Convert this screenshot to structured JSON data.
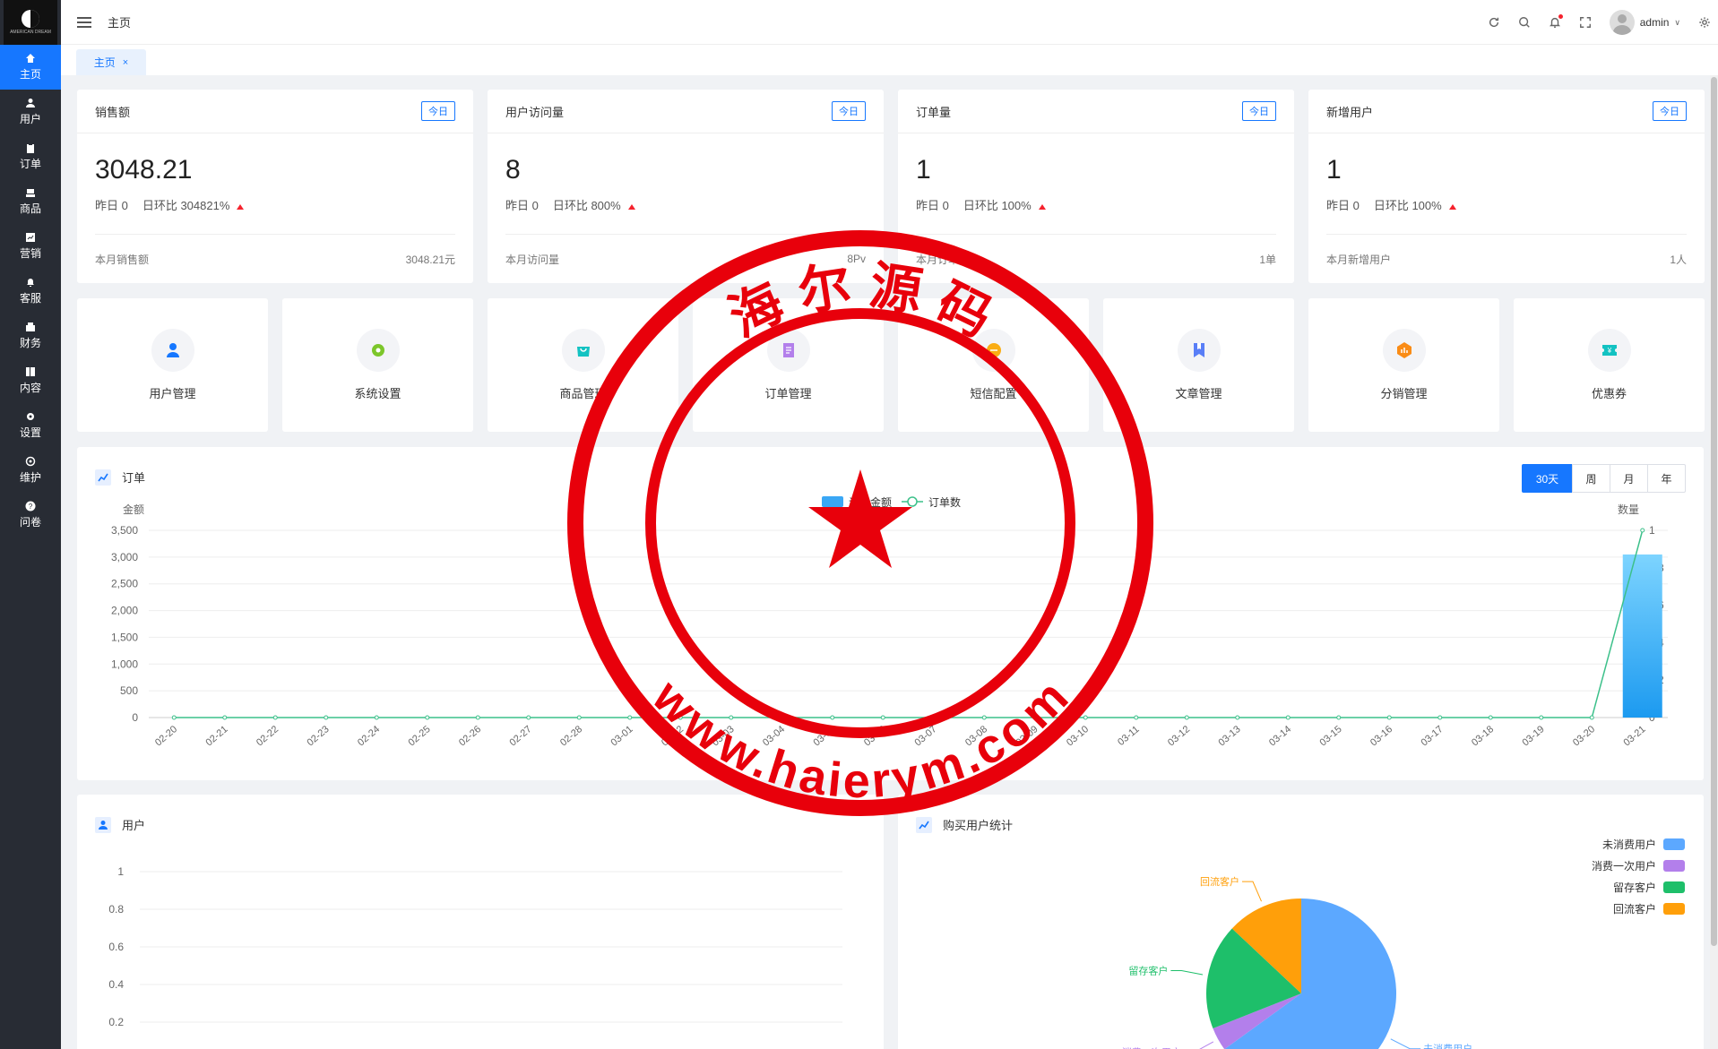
{
  "logo": {
    "text": "AMERICAN DREAM"
  },
  "sidebar": {
    "items": [
      {
        "label": "主页",
        "icon": "home-icon"
      },
      {
        "label": "用户",
        "icon": "user-icon"
      },
      {
        "label": "订单",
        "icon": "clipboard-icon"
      },
      {
        "label": "商品",
        "icon": "product-icon"
      },
      {
        "label": "营销",
        "icon": "chart-icon"
      },
      {
        "label": "客服",
        "icon": "bell-icon"
      },
      {
        "label": "财务",
        "icon": "wallet-icon"
      },
      {
        "label": "内容",
        "icon": "book-icon"
      },
      {
        "label": "设置",
        "icon": "gear-icon"
      },
      {
        "label": "维护",
        "icon": "settings-alt-icon"
      },
      {
        "label": "问卷",
        "icon": "question-icon"
      }
    ]
  },
  "header": {
    "breadcrumb": "主页",
    "username": "admin"
  },
  "tabs": [
    {
      "label": "主页",
      "close": "×"
    }
  ],
  "stats": [
    {
      "title": "销售额",
      "badge": "今日",
      "value": "3048.21",
      "yesterday": "昨日 0",
      "ratio": "日环比 304821%",
      "foot_label": "本月销售额",
      "foot_value": "3048.21元"
    },
    {
      "title": "用户访问量",
      "badge": "今日",
      "value": "8",
      "yesterday": "昨日 0",
      "ratio": "日环比 800%",
      "foot_label": "本月访问量",
      "foot_value": "8Pv"
    },
    {
      "title": "订单量",
      "badge": "今日",
      "value": "1",
      "yesterday": "昨日 0",
      "ratio": "日环比 100%",
      "foot_label": "本月订单量",
      "foot_value": "1单"
    },
    {
      "title": "新增用户",
      "badge": "今日",
      "value": "1",
      "yesterday": "昨日 0",
      "ratio": "日环比 100%",
      "foot_label": "本月新增用户",
      "foot_value": "1人"
    }
  ],
  "shortcuts": [
    {
      "label": "用户管理",
      "icon": "user-manage-icon",
      "color": "#1677ff"
    },
    {
      "label": "系统设置",
      "icon": "gear-icon",
      "color": "#7cc62a"
    },
    {
      "label": "商品管理",
      "icon": "shop-bag-icon",
      "color": "#13c2c2"
    },
    {
      "label": "订单管理",
      "icon": "order-doc-icon",
      "color": "#b37feb"
    },
    {
      "label": "短信配置",
      "icon": "sms-icon",
      "color": "#faad14"
    },
    {
      "label": "文章管理",
      "icon": "bookmark-icon",
      "color": "#597ef7"
    },
    {
      "label": "分销管理",
      "icon": "distribution-icon",
      "color": "#fa8c16"
    },
    {
      "label": "优惠券",
      "icon": "coupon-icon",
      "color": "#13c2c2"
    }
  ],
  "order_panel": {
    "title": "订单",
    "ranges": [
      "30天",
      "周",
      "月",
      "年"
    ],
    "active_range": "30天"
  },
  "user_panel": {
    "title": "用户"
  },
  "buy_panel": {
    "title": "购买用户统计"
  },
  "watermark": {
    "top_text": "海 尔 源 码",
    "bottom_text": "www.haierym.com"
  },
  "chart_data": [
    {
      "type": "bar",
      "title": "订单",
      "categories": [
        "02-20",
        "02-21",
        "02-22",
        "02-23",
        "02-24",
        "02-25",
        "02-26",
        "02-27",
        "02-28",
        "03-01",
        "03-02",
        "03-03",
        "03-04",
        "03-05",
        "03-06",
        "03-07",
        "03-08",
        "03-09",
        "03-10",
        "03-11",
        "03-12",
        "03-13",
        "03-14",
        "03-15",
        "03-16",
        "03-17",
        "03-18",
        "03-19",
        "03-20",
        "03-21"
      ],
      "series": [
        {
          "name": "订单金额",
          "type": "bar",
          "axis": "left",
          "values": [
            0,
            0,
            0,
            0,
            0,
            0,
            0,
            0,
            0,
            0,
            0,
            0,
            0,
            0,
            0,
            0,
            0,
            0,
            0,
            0,
            0,
            0,
            0,
            0,
            0,
            0,
            0,
            0,
            0,
            3048.21
          ]
        },
        {
          "name": "订单数",
          "type": "line",
          "axis": "right",
          "values": [
            0,
            0,
            0,
            0,
            0,
            0,
            0,
            0,
            0,
            0,
            0,
            0,
            0,
            0,
            0,
            0,
            0,
            0,
            0,
            0,
            0,
            0,
            0,
            0,
            0,
            0,
            0,
            0,
            0,
            1
          ]
        }
      ],
      "ylabel": "金额",
      "y2label": "数量",
      "ylim": [
        0,
        3500
      ],
      "yticks": [
        "3,500",
        "3,000",
        "2,500",
        "2,000",
        "1,500",
        "1,000",
        "500",
        "0"
      ],
      "y2lim": [
        0,
        1
      ],
      "y2ticks": [
        "1",
        "0.8",
        "0.6",
        "0.4",
        "0.2",
        "0"
      ],
      "legend": "top-center",
      "grid": true
    },
    {
      "type": "line",
      "title": "用户",
      "yticks": [
        "1",
        "0.8",
        "0.6",
        "0.4",
        "0.2"
      ],
      "grid": true
    },
    {
      "type": "pie",
      "title": "购买用户统计",
      "slices": [
        {
          "name": "未消费用户",
          "value": 65,
          "color": "#5ca8ff"
        },
        {
          "name": "消费一次用户",
          "value": 4,
          "color": "#b37feb"
        },
        {
          "name": "留存客户",
          "value": 18,
          "color": "#1ebf6a"
        },
        {
          "name": "回流客户",
          "value": 13,
          "color": "#ff9f0a"
        }
      ],
      "legend": "top-right"
    }
  ]
}
